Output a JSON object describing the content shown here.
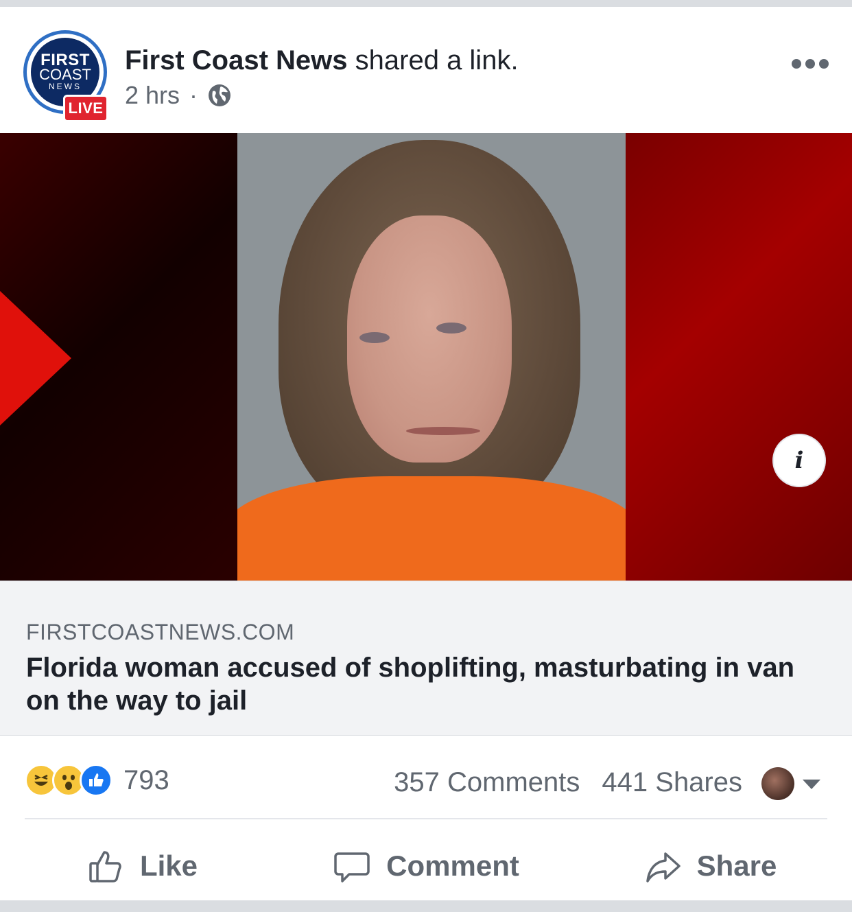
{
  "post": {
    "avatar": {
      "first": "FIRST",
      "coast": "COAST",
      "news": "NEWS",
      "live_badge": "LIVE"
    },
    "page_name": "First Coast News",
    "action_text": " shared a link.",
    "time": "2 hrs",
    "separator": "·",
    "privacy_icon": "globe-icon",
    "more_icon": "more-dots-icon"
  },
  "link": {
    "domain": "FIRSTCOASTNEWS.COM",
    "title": "Florida woman accused of shoplifting, masturbating in van on the way to jail",
    "info_icon": "i"
  },
  "stats": {
    "reactions": [
      "haha",
      "wow",
      "like"
    ],
    "reaction_count": "793",
    "comments": "357 Comments",
    "shares": "441 Shares"
  },
  "actions": {
    "like": "Like",
    "comment": "Comment",
    "share": "Share"
  },
  "colors": {
    "brand_blue": "#1877f2",
    "live_red": "#e0242f",
    "text_secondary": "#606770"
  }
}
